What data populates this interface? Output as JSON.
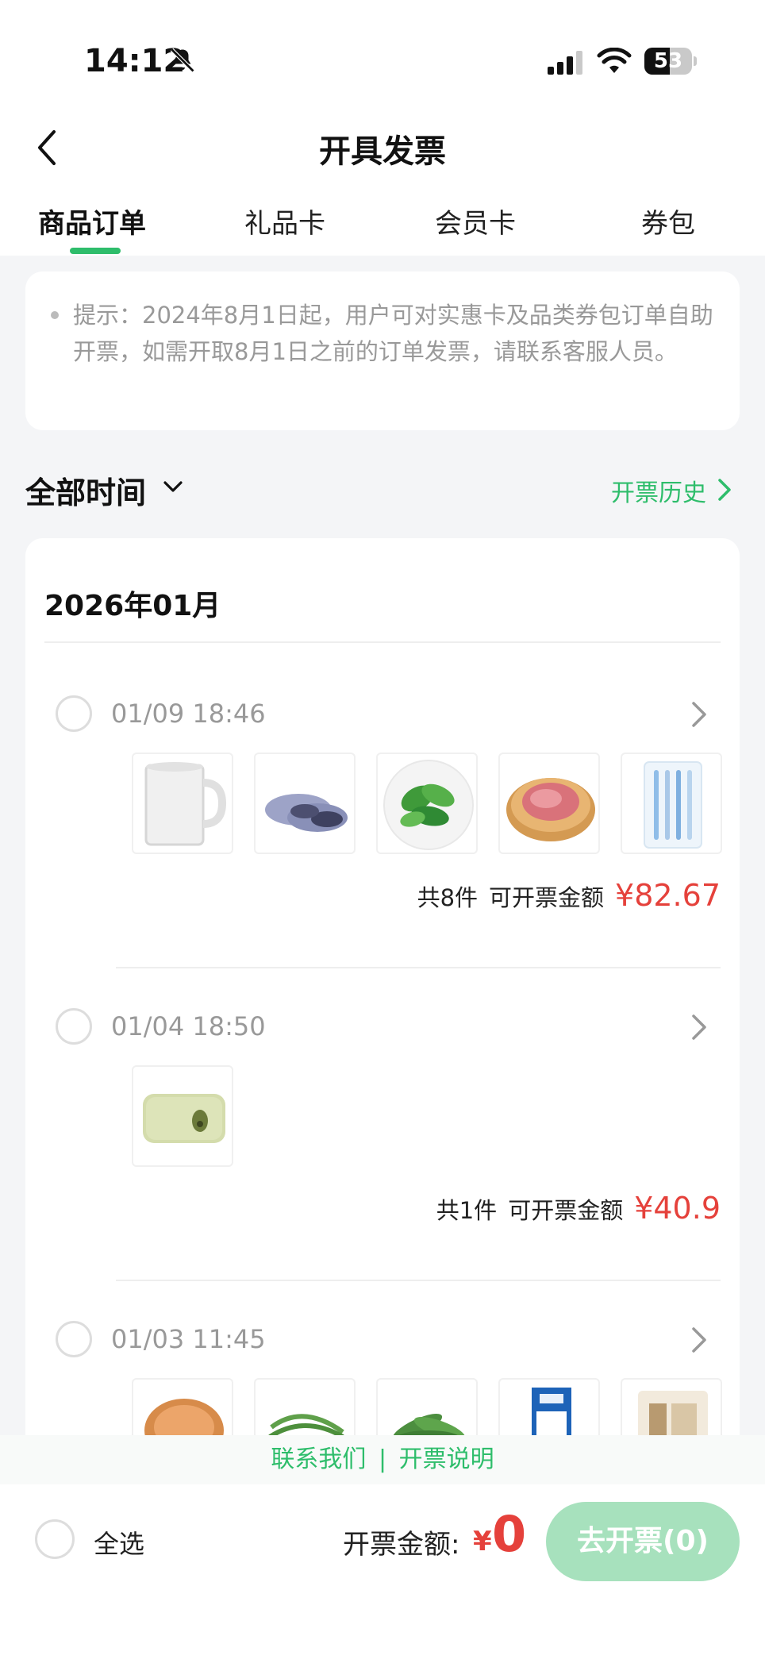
{
  "status_bar": {
    "time": "14:12",
    "battery": "53",
    "battery_level": 0.53
  },
  "header": {
    "title": "开具发票"
  },
  "tabs": [
    {
      "label": "商品订单",
      "active": true
    },
    {
      "label": "礼品卡",
      "active": false
    },
    {
      "label": "会员卡",
      "active": false
    },
    {
      "label": "券包",
      "active": false
    }
  ],
  "notice": {
    "text": "提示：2024年8月1日起，用户可对实惠卡及品类券包订单自助开票，如需开取8月1日之前的订单发票，请联系客服人员。"
  },
  "filter": {
    "label": "全部时间",
    "history_link": "开票历史"
  },
  "orders_section": {
    "month": "2026年01月",
    "orders": [
      {
        "datetime": "01/09 18:46",
        "items": [
          "mug",
          "slippers",
          "greens",
          "minced-meat",
          "toothbrushes"
        ],
        "count_text": "共8件",
        "amount_label": "可开票金额",
        "amount": "¥82.67"
      },
      {
        "datetime": "01/04 18:50",
        "items": [
          "soap"
        ],
        "count_text": "共1件",
        "amount_label": "可开票金额",
        "amount": "¥40.9"
      },
      {
        "datetime": "01/03 11:45",
        "items": [
          "bread",
          "beans",
          "greens",
          "milk-box",
          "snack"
        ]
      }
    ]
  },
  "footer_links": {
    "contact": "联系我们",
    "separator": "|",
    "explain": "开票说明"
  },
  "bottom_bar": {
    "select_all": "全选",
    "total_label": "开票金额:",
    "currency": "¥",
    "total_value": "0",
    "invoice_button": "去开票(0)"
  },
  "colors": {
    "accent": "#2ebd6b",
    "price": "#e5413b",
    "button_disabled": "#a7e1bd"
  }
}
